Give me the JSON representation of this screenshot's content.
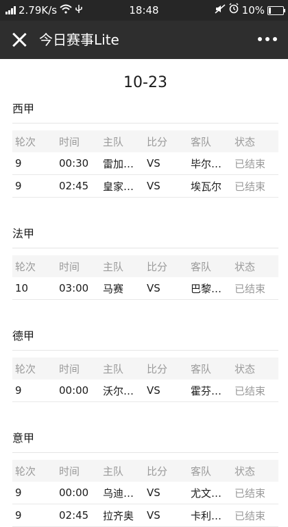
{
  "statusbar": {
    "speed": "2.79K/s",
    "time": "18:48",
    "battery": "10%"
  },
  "navbar": {
    "title": "今日赛事Lite"
  },
  "date": "10-23",
  "headers": [
    "轮次",
    "时间",
    "主队",
    "比分",
    "客队",
    "状态"
  ],
  "leagues": [
    {
      "name": "西甲",
      "matches": [
        {
          "round": "9",
          "time": "00:30",
          "home": "雷加…",
          "score": "VS",
          "away": "毕尔…",
          "status": "已结束"
        },
        {
          "round": "9",
          "time": "02:45",
          "home": "皇家…",
          "score": "VS",
          "away": "埃瓦尔",
          "status": "已结束"
        }
      ]
    },
    {
      "name": "法甲",
      "matches": [
        {
          "round": "10",
          "time": "03:00",
          "home": "马赛",
          "score": "VS",
          "away": "巴黎…",
          "status": "已结束"
        }
      ]
    },
    {
      "name": "德甲",
      "matches": [
        {
          "round": "9",
          "time": "00:00",
          "home": "沃尔…",
          "score": "VS",
          "away": "霍芬…",
          "status": "已结束"
        }
      ]
    },
    {
      "name": "意甲",
      "matches": [
        {
          "round": "9",
          "time": "00:00",
          "home": "乌迪…",
          "score": "VS",
          "away": "尤文…",
          "status": "已结束"
        },
        {
          "round": "9",
          "time": "02:45",
          "home": "拉齐奥",
          "score": "VS",
          "away": "卡利…",
          "status": "已结束"
        }
      ]
    }
  ]
}
